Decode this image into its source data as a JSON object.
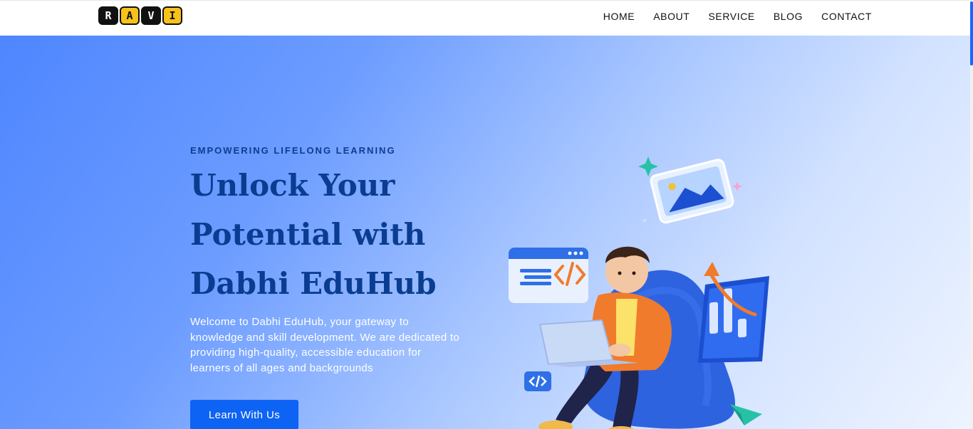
{
  "logo": {
    "letters": [
      "R",
      "A",
      "V",
      "I"
    ]
  },
  "nav": {
    "items": [
      "HOME",
      "ABOUT",
      "SERVICE",
      "BLOG",
      "CONTACT"
    ]
  },
  "hero": {
    "tagline": "EMPOWERING LIFELONG LEARNING",
    "headline_lines": [
      "Unlock Your",
      "Potential with",
      "Dabhi EduHub"
    ],
    "intro": "Welcome to Dabhi EduHub, your gateway to knowledge and skill development. We are dedicated to providing high-quality, accessible education for learners of all ages and backgrounds",
    "cta_label": "Learn With Us"
  },
  "colors": {
    "accent": "#0d63f3",
    "headline": "#0a3d91",
    "logo_yellow": "#f7c21b"
  },
  "icons": [
    "code-window-icon",
    "chart-icon",
    "image-card-icon",
    "code-badge-icon",
    "paper-plane-icon",
    "sparkle-icon"
  ]
}
